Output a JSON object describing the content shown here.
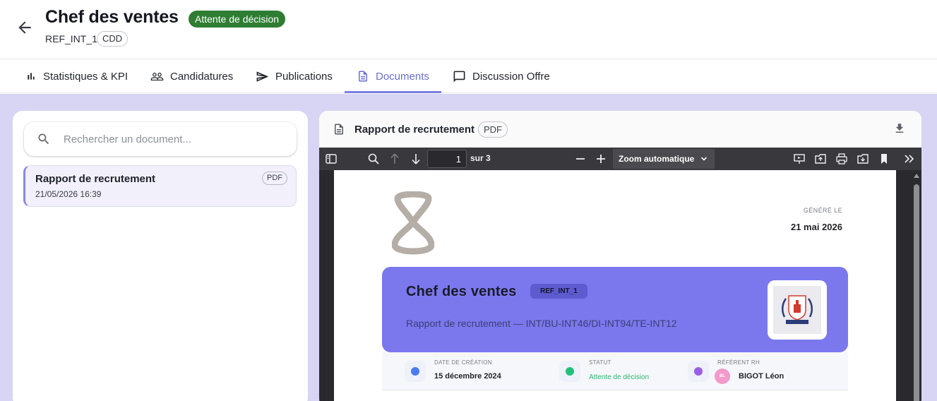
{
  "header": {
    "title": "Chef des ventes",
    "status": "Attente de décision",
    "reference": "REF_INT_1",
    "contract_type": "CDD"
  },
  "tabs": [
    {
      "label": "Statistiques & KPI",
      "icon": "bar-chart-icon",
      "active": false
    },
    {
      "label": "Candidatures",
      "icon": "people-icon",
      "active": false
    },
    {
      "label": "Publications",
      "icon": "send-icon",
      "active": false
    },
    {
      "label": "Documents",
      "icon": "document-icon",
      "active": true
    },
    {
      "label": "Discussion Offre",
      "icon": "chat-icon",
      "active": false
    }
  ],
  "documents_panel": {
    "search_placeholder": "Rechercher un document...",
    "items": [
      {
        "name": "Rapport de recrutement",
        "date": "21/05/2026 16:39",
        "type": "PDF",
        "selected": true
      }
    ]
  },
  "viewer": {
    "title": "Rapport de recrutement",
    "type": "PDF",
    "toolbar": {
      "page_current": "1",
      "page_total_label": "sur 3",
      "zoom": "Zoom automatique"
    },
    "page": {
      "generated_label": "GÉNÉRÉ LE",
      "generated_date": "21 mai 2026",
      "banner_title": "Chef des ventes",
      "banner_ref": "REF_INT_1",
      "banner_subtitle": "Rapport de recrutement — INT/BU-INT46/DI-INT94/TE-INT12",
      "meta": [
        {
          "label": "DATE DE CRÉATION",
          "value": "15 décembre 2024",
          "color": "#4a7cf0"
        },
        {
          "label": "STATUT",
          "value": "Attente de décision",
          "color": "#22c07a"
        },
        {
          "label": "RÉFÉRENT RH",
          "value": "BIGOT Léon",
          "avatar": "BL",
          "color": "#9b5de5"
        }
      ]
    }
  },
  "colors": {
    "accent": "#6b6fd6",
    "status_green": "#2e7d32",
    "workspace_bg": "#d7d5f3",
    "banner": "#7b78ee"
  }
}
